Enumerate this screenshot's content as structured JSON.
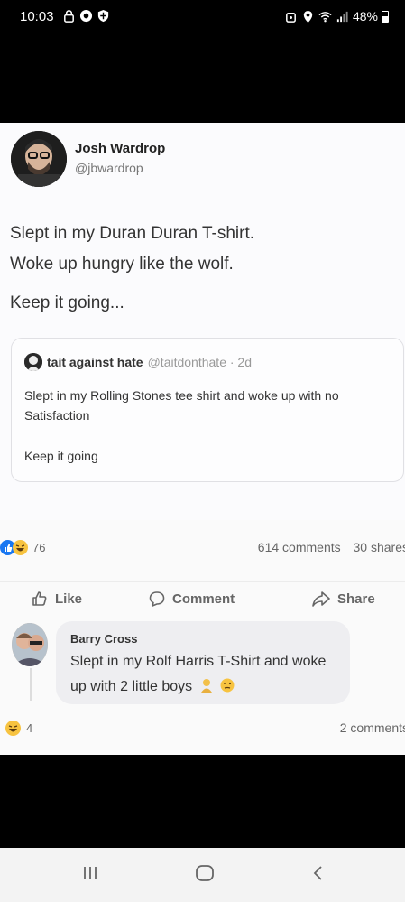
{
  "status_bar": {
    "time": "10:03",
    "battery": "48%",
    "icons_left": [
      "lock-icon",
      "chrome-icon",
      "shield-icon"
    ],
    "icons_right": [
      "alarm-icon",
      "location-icon",
      "wifi-icon",
      "signal-icon",
      "battery-icon"
    ]
  },
  "tweet": {
    "author_name": "Josh Wardrop",
    "author_handle": "@jbwardrop",
    "lines": [
      "Slept in my Duran Duran T-shirt.",
      "Woke up hungry like the wolf.",
      "Keep it going..."
    ],
    "quote": {
      "author_name": "tait against hate",
      "author_handle": "@taitdonthate · 2d",
      "text": "Slept in my Rolling Stones tee shirt and  woke up with no Satisfaction",
      "text2": "Keep it going"
    }
  },
  "facebook": {
    "reaction_count": "76",
    "comments_count": "614 comments",
    "shares_count": "30 shares",
    "actions": {
      "like": "Like",
      "comment": "Comment",
      "share": "Share"
    },
    "comment": {
      "author": "Barry Cross",
      "text": "Slept in my Rolf Harris T-Shirt and woke up with 2 little boys",
      "reaction_count": "4",
      "reply_count": "2 comments"
    }
  },
  "colors": {
    "like_blue": "#1877f2",
    "haha_yellow": "#f7c340"
  }
}
